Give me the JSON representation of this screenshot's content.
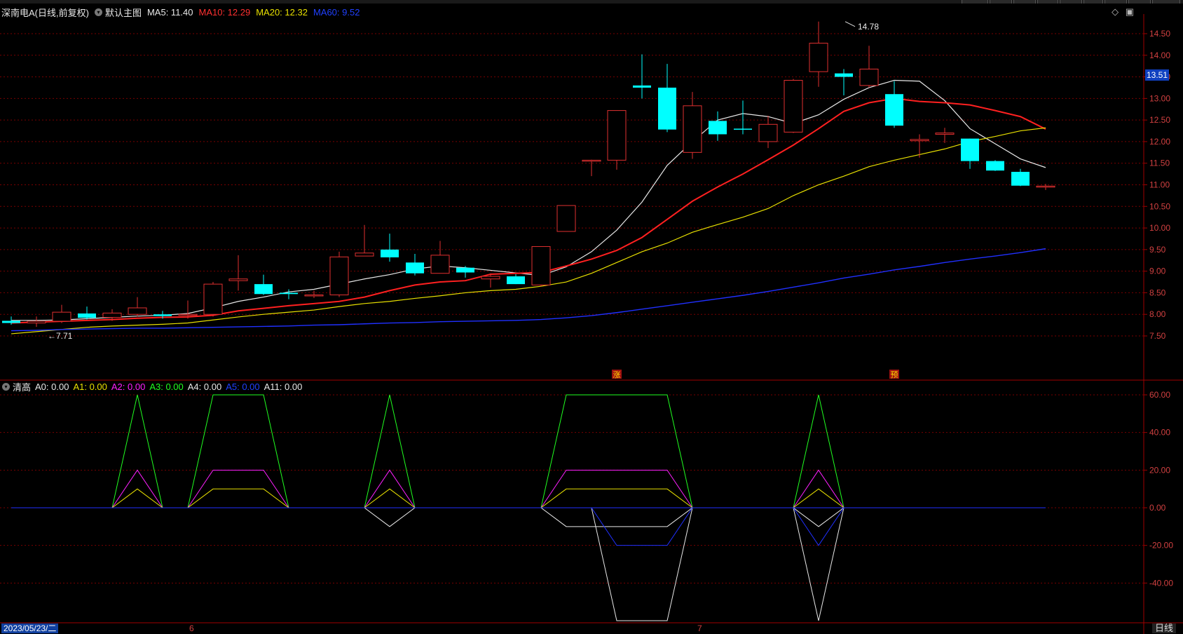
{
  "header": {
    "stock_title": "深南电A(日线,前复权)",
    "main_chart_label": "默认主图",
    "ma5": "MA5: 11.40",
    "ma10": "MA10: 12.29",
    "ma20": "MA20: 12.32",
    "ma60": "MA60: 9.52"
  },
  "indicator": {
    "name": "清高",
    "a0": "A0: 0.00",
    "a1": "A1: 0.00",
    "a2": "A2: 0.00",
    "a3": "A3: 0.00",
    "a4": "A4: 0.00",
    "a5": "A5: 0.00",
    "a11": "A11: 0.00"
  },
  "price_tag": "13.51",
  "date_axis": {
    "start_date": "2023/05/23/二",
    "month_6": "6",
    "month_7": "7",
    "period_button": "日线"
  },
  "colors": {
    "up": "#e03030",
    "down": "#00ffff",
    "ma5": "#e8e8e8",
    "ma10": "#ff2020",
    "ma20": "#e8e000",
    "ma60": "#2030ff",
    "grid": "#7a0000"
  },
  "chart_data": [
    {
      "type": "candlestick",
      "title": "深南电A(日线,前复权)",
      "ylim": [
        7.2,
        14.8
      ],
      "y_ticks": [
        "14.50",
        "14.00",
        "13.50",
        "13.00",
        "12.50",
        "12.00",
        "11.50",
        "11.00",
        "10.50",
        "10.00",
        "9.50",
        "9.00",
        "8.50",
        "8.00",
        "7.50"
      ],
      "annotations": [
        {
          "text": "14.78",
          "at_index": 33,
          "value": 14.78
        },
        {
          "text": "7.71",
          "at_index": 1,
          "value": 7.71
        },
        {
          "text": "涨",
          "at_index": 24
        },
        {
          "text": "预",
          "at_index": 35
        }
      ],
      "candles": [
        {
          "o": 7.85,
          "h": 7.95,
          "l": 7.76,
          "c": 7.8
        },
        {
          "o": 7.8,
          "h": 7.95,
          "l": 7.71,
          "c": 7.84
        },
        {
          "o": 7.84,
          "h": 8.22,
          "l": 7.8,
          "c": 8.05
        },
        {
          "o": 8.02,
          "h": 8.18,
          "l": 7.88,
          "c": 7.92
        },
        {
          "o": 7.93,
          "h": 8.12,
          "l": 7.85,
          "c": 8.03
        },
        {
          "o": 8.0,
          "h": 8.4,
          "l": 7.95,
          "c": 8.15
        },
        {
          "o": 8.0,
          "h": 8.08,
          "l": 7.9,
          "c": 7.96
        },
        {
          "o": 7.98,
          "h": 8.32,
          "l": 7.9,
          "c": 8.0
        },
        {
          "o": 8.0,
          "h": 8.75,
          "l": 7.95,
          "c": 8.7
        },
        {
          "o": 8.78,
          "h": 9.37,
          "l": 8.55,
          "c": 8.82
        },
        {
          "o": 8.7,
          "h": 8.92,
          "l": 8.45,
          "c": 8.47
        },
        {
          "o": 8.5,
          "h": 8.58,
          "l": 8.35,
          "c": 8.47
        },
        {
          "o": 8.45,
          "h": 8.55,
          "l": 8.38,
          "c": 8.45
        },
        {
          "o": 8.45,
          "h": 9.45,
          "l": 8.4,
          "c": 9.33
        },
        {
          "o": 9.35,
          "h": 10.07,
          "l": 9.35,
          "c": 9.42
        },
        {
          "o": 9.5,
          "h": 9.87,
          "l": 9.22,
          "c": 9.32
        },
        {
          "o": 9.2,
          "h": 9.4,
          "l": 8.9,
          "c": 8.95
        },
        {
          "o": 8.95,
          "h": 9.7,
          "l": 8.95,
          "c": 9.37
        },
        {
          "o": 9.08,
          "h": 9.12,
          "l": 8.85,
          "c": 8.97
        },
        {
          "o": 8.82,
          "h": 8.95,
          "l": 8.62,
          "c": 8.88
        },
        {
          "o": 8.88,
          "h": 8.93,
          "l": 8.7,
          "c": 8.7
        },
        {
          "o": 8.68,
          "h": 9.57,
          "l": 8.65,
          "c": 9.57
        },
        {
          "o": 9.92,
          "h": 10.52,
          "l": 9.92,
          "c": 10.52
        },
        {
          "o": 11.57,
          "h": 11.58,
          "l": 11.2,
          "c": 11.57
        },
        {
          "o": 11.57,
          "h": 12.72,
          "l": 11.35,
          "c": 12.72
        },
        {
          "o": 13.3,
          "h": 14.02,
          "l": 13.0,
          "c": 13.25
        },
        {
          "o": 13.25,
          "h": 13.8,
          "l": 12.22,
          "c": 12.28
        },
        {
          "o": 11.75,
          "h": 13.15,
          "l": 11.6,
          "c": 12.83
        },
        {
          "o": 12.48,
          "h": 12.7,
          "l": 12.02,
          "c": 12.17
        },
        {
          "o": 12.3,
          "h": 12.95,
          "l": 12.17,
          "c": 12.28
        },
        {
          "o": 12.0,
          "h": 12.6,
          "l": 11.85,
          "c": 12.4
        },
        {
          "o": 12.22,
          "h": 13.45,
          "l": 12.2,
          "c": 13.42
        },
        {
          "o": 13.62,
          "h": 14.78,
          "l": 13.27,
          "c": 14.28
        },
        {
          "o": 13.58,
          "h": 13.68,
          "l": 13.07,
          "c": 13.5
        },
        {
          "o": 13.3,
          "h": 14.22,
          "l": 13.25,
          "c": 13.68
        },
        {
          "o": 13.1,
          "h": 13.4,
          "l": 12.32,
          "c": 12.37
        },
        {
          "o": 12.02,
          "h": 12.17,
          "l": 11.63,
          "c": 12.05
        },
        {
          "o": 12.17,
          "h": 12.32,
          "l": 11.97,
          "c": 12.2
        },
        {
          "o": 12.07,
          "h": 12.07,
          "l": 11.37,
          "c": 11.55
        },
        {
          "o": 11.55,
          "h": 11.57,
          "l": 11.32,
          "c": 11.33
        },
        {
          "o": 11.3,
          "h": 11.37,
          "l": 10.97,
          "c": 10.98
        },
        {
          "o": 10.95,
          "h": 11.02,
          "l": 10.88,
          "c": 10.97
        }
      ],
      "series": [
        {
          "name": "MA5",
          "values": [
            7.86,
            7.86,
            7.87,
            7.9,
            7.93,
            7.96,
            7.98,
            8.02,
            8.15,
            8.3,
            8.4,
            8.52,
            8.58,
            8.7,
            8.82,
            8.92,
            9.05,
            9.12,
            9.08,
            9.02,
            8.96,
            8.9,
            9.1,
            9.45,
            9.95,
            10.6,
            11.45,
            12.0,
            12.5,
            12.65,
            12.58,
            12.42,
            12.62,
            12.98,
            13.25,
            13.42,
            13.4,
            12.95,
            12.3,
            11.95,
            11.6,
            11.4
          ]
        },
        {
          "name": "MA10",
          "values": [
            7.8,
            7.82,
            7.84,
            7.86,
            7.88,
            7.91,
            7.93,
            7.94,
            7.98,
            8.08,
            8.14,
            8.2,
            8.25,
            8.3,
            8.4,
            8.55,
            8.68,
            8.75,
            8.78,
            8.93,
            8.95,
            8.97,
            9.12,
            9.28,
            9.48,
            9.78,
            10.2,
            10.62,
            10.95,
            11.25,
            11.58,
            11.92,
            12.3,
            12.7,
            12.9,
            13.0,
            12.93,
            12.9,
            12.85,
            12.72,
            12.58,
            12.29
          ]
        },
        {
          "name": "MA20",
          "values": [
            7.55,
            7.6,
            7.65,
            7.7,
            7.73,
            7.75,
            7.77,
            7.8,
            7.87,
            7.94,
            8.0,
            8.05,
            8.1,
            8.18,
            8.25,
            8.3,
            8.37,
            8.43,
            8.5,
            8.55,
            8.58,
            8.65,
            8.75,
            8.95,
            9.2,
            9.45,
            9.65,
            9.9,
            10.08,
            10.25,
            10.45,
            10.75,
            11.0,
            11.2,
            11.42,
            11.57,
            11.7,
            11.83,
            12.0,
            12.12,
            12.25,
            12.32
          ]
        },
        {
          "name": "MA60",
          "values": [
            7.62,
            7.63,
            7.65,
            7.66,
            7.67,
            7.68,
            7.68,
            7.69,
            7.7,
            7.71,
            7.72,
            7.73,
            7.75,
            7.76,
            7.78,
            7.8,
            7.81,
            7.83,
            7.84,
            7.85,
            7.86,
            7.88,
            7.92,
            7.97,
            8.04,
            8.12,
            8.2,
            8.28,
            8.36,
            8.44,
            8.53,
            8.63,
            8.73,
            8.84,
            8.93,
            9.03,
            9.11,
            9.2,
            9.28,
            9.35,
            9.43,
            9.52
          ]
        }
      ]
    },
    {
      "type": "line",
      "title": "清高",
      "ylim": [
        -60,
        68
      ],
      "y_ticks": [
        "60.00",
        "40.00",
        "20.00",
        "0.00",
        "-20.00",
        "-40.00"
      ],
      "series": [
        {
          "name": "A3",
          "values": [
            0,
            0,
            0,
            0,
            0,
            60,
            0,
            0,
            60,
            60,
            60,
            0,
            0,
            0,
            0,
            60,
            0,
            0,
            0,
            0,
            0,
            0,
            60,
            60,
            60,
            60,
            60,
            0,
            0,
            0,
            0,
            0,
            60,
            0,
            0,
            0,
            0,
            0,
            0,
            0,
            0,
            0
          ]
        },
        {
          "name": "A2",
          "values": [
            0,
            0,
            0,
            0,
            0,
            20,
            0,
            0,
            20,
            20,
            20,
            0,
            0,
            0,
            0,
            20,
            0,
            0,
            0,
            0,
            0,
            0,
            20,
            20,
            20,
            20,
            20,
            0,
            0,
            0,
            0,
            0,
            20,
            0,
            0,
            0,
            0,
            0,
            0,
            0,
            0,
            0
          ]
        },
        {
          "name": "A1",
          "values": [
            0,
            0,
            0,
            0,
            0,
            10,
            0,
            0,
            10,
            10,
            10,
            0,
            0,
            0,
            0,
            10,
            0,
            0,
            0,
            0,
            0,
            0,
            10,
            10,
            10,
            10,
            10,
            0,
            0,
            0,
            0,
            0,
            10,
            0,
            0,
            0,
            0,
            0,
            0,
            0,
            0,
            0
          ]
        },
        {
          "name": "A4",
          "values": [
            0,
            0,
            0,
            0,
            0,
            0,
            0,
            0,
            0,
            0,
            0,
            0,
            0,
            0,
            0,
            -10,
            0,
            0,
            0,
            0,
            0,
            0,
            -10,
            -10,
            -10,
            -10,
            -10,
            0,
            0,
            0,
            0,
            0,
            -10,
            0,
            0,
            0,
            0,
            0,
            0,
            0,
            0,
            0
          ]
        },
        {
          "name": "A11",
          "values": [
            0,
            0,
            0,
            0,
            0,
            0,
            0,
            0,
            0,
            0,
            0,
            0,
            0,
            0,
            0,
            0,
            0,
            0,
            0,
            0,
            0,
            0,
            0,
            0,
            -60,
            -60,
            -60,
            0,
            0,
            0,
            0,
            0,
            -60,
            0,
            0,
            0,
            0,
            0,
            0,
            0,
            0,
            0
          ]
        },
        {
          "name": "A5",
          "values": [
            0,
            0,
            0,
            0,
            0,
            0,
            0,
            0,
            0,
            0,
            0,
            0,
            0,
            0,
            0,
            0,
            0,
            0,
            0,
            0,
            0,
            0,
            0,
            0,
            -20,
            -20,
            -20,
            0,
            0,
            0,
            0,
            0,
            -20,
            0,
            0,
            0,
            0,
            0,
            0,
            0,
            0,
            0
          ]
        },
        {
          "name": "A0",
          "values": [
            0,
            0,
            0,
            0,
            0,
            0,
            0,
            0,
            0,
            0,
            0,
            0,
            0,
            0,
            0,
            0,
            0,
            0,
            0,
            0,
            0,
            0,
            0,
            0,
            0,
            0,
            0,
            0,
            0,
            0,
            0,
            0,
            0,
            0,
            0,
            0,
            0,
            0,
            0,
            0,
            0,
            0
          ]
        }
      ]
    }
  ]
}
